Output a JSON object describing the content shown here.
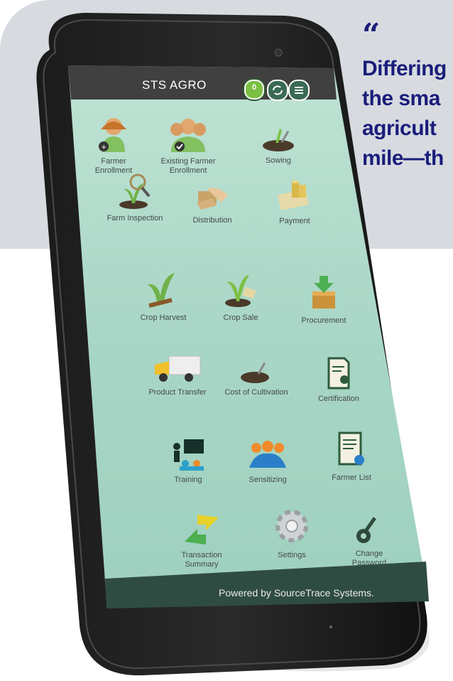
{
  "quote": {
    "mark": "“",
    "lines": [
      "Differing",
      "the sma",
      "agricult",
      "mile—th"
    ]
  },
  "app": {
    "title": "STS AGRO",
    "toggle_label": "0",
    "footer": "Powered by SourceTrace Systems."
  },
  "tiles": [
    {
      "label": "Farmer Enrollment",
      "icon": "farmer-add-icon"
    },
    {
      "label": "Existing Farmer Enrollment",
      "icon": "farmers-check-icon"
    },
    {
      "label": "Sowing",
      "icon": "sowing-icon"
    },
    {
      "label": "Farm Inspection",
      "icon": "inspection-icon"
    },
    {
      "label": "Distribution",
      "icon": "distribution-icon"
    },
    {
      "label": "Payment",
      "icon": "payment-icon"
    },
    {
      "label": "Crop Harvest",
      "icon": "harvest-icon"
    },
    {
      "label": "Crop Sale",
      "icon": "crop-sale-icon"
    },
    {
      "label": "Procurement",
      "icon": "procurement-icon"
    },
    {
      "label": "Product Transfer",
      "icon": "truck-icon"
    },
    {
      "label": "Cost of Cultivation",
      "icon": "soil-icon"
    },
    {
      "label": "Certification",
      "icon": "certificate-icon"
    },
    {
      "label": "Training",
      "icon": "training-icon"
    },
    {
      "label": "Sensitizing",
      "icon": "group-icon"
    },
    {
      "label": "Farmer List",
      "icon": "list-icon"
    },
    {
      "label": "Transaction Summary",
      "icon": "arrows-icon"
    },
    {
      "label": "Settings",
      "icon": "gear-icon"
    },
    {
      "label": "Change Password",
      "icon": "key-icon"
    }
  ],
  "colors": {
    "quote": "#1a1d7a",
    "screen": "#b7ddcf",
    "header": "#3f403f",
    "footer": "#2f4c43"
  }
}
